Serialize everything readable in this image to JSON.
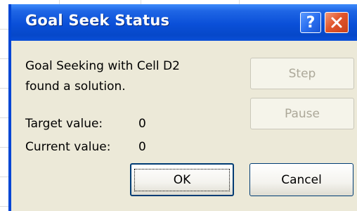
{
  "dialog": {
    "title": "Goal Seek Status",
    "help_label": "?",
    "message_line1": "Goal Seeking with Cell D2",
    "message_line2": "found a solution.",
    "target_label": "Target value:",
    "target_value": "0",
    "current_label": "Current value:",
    "current_value": "0",
    "buttons": {
      "step": "Step",
      "pause": "Pause",
      "ok": "OK",
      "cancel": "Cancel"
    }
  },
  "icons": {
    "help": "help-icon",
    "close": "close-icon"
  },
  "colors": {
    "title_bar": "#0a4fd8",
    "dialog_face": "#ece9d8",
    "close_button": "#e2562b",
    "disabled_text": "#aca899"
  }
}
